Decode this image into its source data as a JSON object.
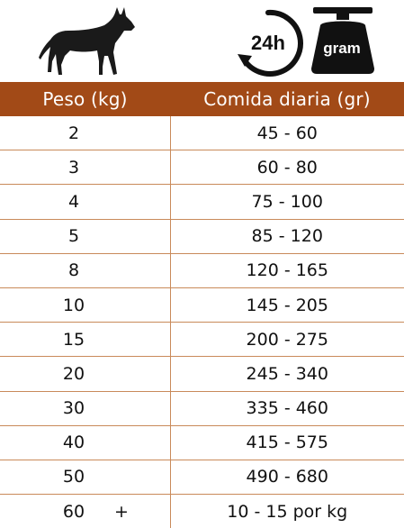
{
  "icons": {
    "dog": "dog-silhouette-icon",
    "clock": "24h-clock-icon",
    "scale": "gram-scale-icon",
    "clock_label": "24h",
    "scale_label": "gram"
  },
  "colors": {
    "header_background": "#a24a17",
    "header_text": "#ffffff",
    "rule": "#c98a5a"
  },
  "table": {
    "headers": {
      "weight": "Peso (kg)",
      "food": "Comida diaria (gr)"
    },
    "rows": [
      {
        "weight": "2",
        "food": "45 - 60"
      },
      {
        "weight": "3",
        "food": "60 - 80"
      },
      {
        "weight": "4",
        "food": "75 - 100"
      },
      {
        "weight": "5",
        "food": "85 - 120"
      },
      {
        "weight": "8",
        "food": "120 - 165"
      },
      {
        "weight": "10",
        "food": "145 - 205"
      },
      {
        "weight": "15",
        "food": "200 - 275"
      },
      {
        "weight": "20",
        "food": "245 - 340"
      },
      {
        "weight": "30",
        "food": "335 - 460"
      },
      {
        "weight": "40",
        "food": "415 - 575"
      },
      {
        "weight": "50",
        "food": "490 - 680"
      },
      {
        "weight": "60",
        "weight_suffix": "+",
        "food": "10 - 15 por kg"
      }
    ]
  }
}
